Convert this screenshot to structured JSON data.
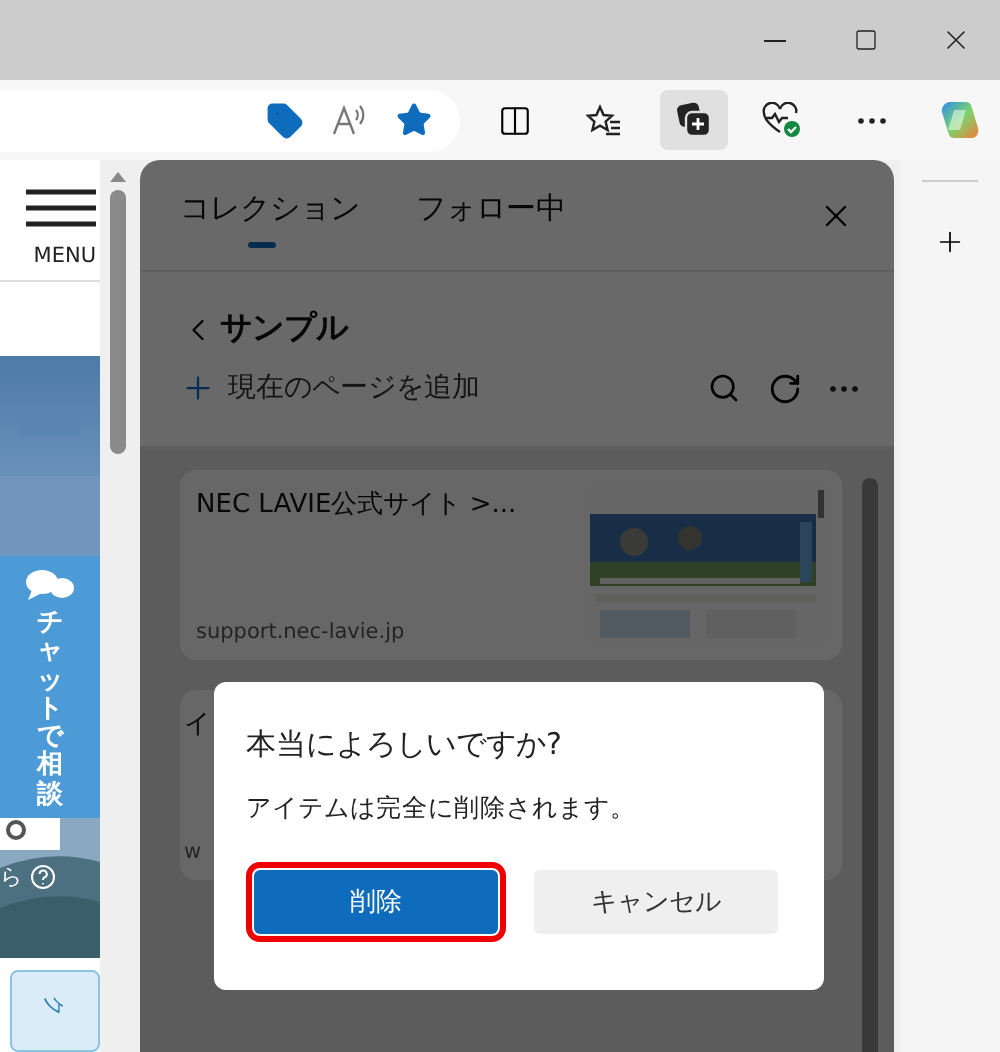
{
  "toolbar": {
    "buttons": [
      {
        "kind": "split",
        "selected": false
      },
      {
        "kind": "favorites",
        "selected": false
      },
      {
        "kind": "collections",
        "selected": true
      },
      {
        "kind": "health",
        "selected": false
      },
      {
        "kind": "more",
        "selected": false
      },
      {
        "kind": "copilot",
        "selected": false
      }
    ]
  },
  "page": {
    "menu_label": "MENU",
    "chat_label": "チャットで相談",
    "help_text": "ら",
    "tile_label": "ク"
  },
  "panel": {
    "tabs": [
      {
        "label": "コレクション",
        "selected": true
      },
      {
        "label": "フォロー中",
        "selected": false
      }
    ],
    "collection": {
      "title": "サンプル",
      "add_label": "現在のページを追加"
    },
    "cards": [
      {
        "title": "NEC LAVIE公式サイト >...",
        "url": "support.nec-lavie.jp",
        "kind": "thumbnail"
      },
      {
        "title": "イ",
        "url": "w",
        "kind": "covered"
      }
    ]
  },
  "dialog": {
    "title": "本当によろしいですか?",
    "message": "アイテムは完全に削除されます。",
    "buttons": [
      {
        "label": "削除",
        "kind": "primary",
        "highlighted": true
      },
      {
        "label": "キャンセル",
        "kind": "secondary",
        "highlighted": false
      }
    ]
  }
}
